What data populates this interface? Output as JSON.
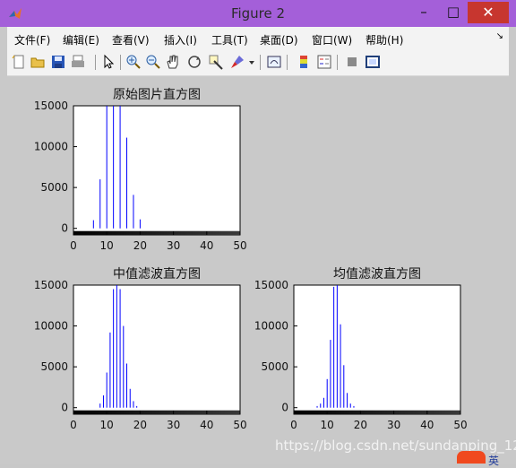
{
  "window": {
    "title": "Figure 2",
    "minimize": "–",
    "maximize": "□",
    "close": "✕",
    "app_icon": "matlab-icon"
  },
  "menu": {
    "items": [
      "文件(F)",
      "编辑(E)",
      "查看(V)",
      "插入(I)",
      "工具(T)",
      "桌面(D)",
      "窗口(W)",
      "帮助(H)"
    ],
    "dock_glyph": "↘"
  },
  "toolbar": {
    "icons": [
      "new-figure-icon",
      "open-file-icon",
      "save-icon",
      "print-icon",
      "pointer-icon",
      "zoom-in-icon",
      "zoom-out-icon",
      "pan-hand-icon",
      "rotate-3d-icon",
      "data-cursor-icon",
      "brush-icon",
      "link-plot-icon",
      "colorbar-icon",
      "legend-icon",
      "hide-plot-tools-icon",
      "show-plot-tools-icon"
    ]
  },
  "colors": {
    "title_bar": "#a45fd9",
    "menu_bg": "#f3f3f3",
    "figure_bg": "#c9c9c9",
    "bar_color": "#0000ff"
  },
  "chart_data": [
    {
      "type": "bar",
      "title": "原始图片直方图",
      "xlim": [
        0,
        50
      ],
      "ylim": [
        -800,
        15000
      ],
      "x_ticks": [
        0,
        10,
        20,
        30,
        40,
        50
      ],
      "y_ticks": [
        0,
        5000,
        10000,
        15000
      ],
      "gray_colorbar": true,
      "bars": [
        {
          "x": 6,
          "value": 1000
        },
        {
          "x": 8,
          "value": 6000
        },
        {
          "x": 10,
          "value": 16000
        },
        {
          "x": 12,
          "value": 16000
        },
        {
          "x": 14,
          "value": 16000
        },
        {
          "x": 16,
          "value": 11100
        },
        {
          "x": 18,
          "value": 4100
        },
        {
          "x": 20,
          "value": 1100
        }
      ]
    },
    {
      "type": "bar",
      "title": "中值滤波直方图",
      "xlim": [
        0,
        50
      ],
      "ylim": [
        -800,
        15000
      ],
      "x_ticks": [
        0,
        10,
        20,
        30,
        40,
        50
      ],
      "y_ticks": [
        0,
        5000,
        10000,
        15000
      ],
      "gray_colorbar": true,
      "bars": [
        {
          "x": 8,
          "value": 500
        },
        {
          "x": 9,
          "value": 1500
        },
        {
          "x": 10,
          "value": 4300
        },
        {
          "x": 11,
          "value": 9200
        },
        {
          "x": 12,
          "value": 14500
        },
        {
          "x": 13,
          "value": 16000
        },
        {
          "x": 14,
          "value": 14500
        },
        {
          "x": 15,
          "value": 10000
        },
        {
          "x": 16,
          "value": 5400
        },
        {
          "x": 17,
          "value": 2300
        },
        {
          "x": 18,
          "value": 800
        },
        {
          "x": 19,
          "value": 200
        }
      ]
    },
    {
      "type": "bar",
      "title": "均值滤波直方图",
      "xlim": [
        0,
        50
      ],
      "ylim": [
        -800,
        15000
      ],
      "x_ticks": [
        0,
        10,
        20,
        30,
        40,
        50
      ],
      "y_ticks": [
        0,
        5000,
        10000,
        15000
      ],
      "gray_colorbar": true,
      "bars": [
        {
          "x": 7,
          "value": 200
        },
        {
          "x": 8,
          "value": 500
        },
        {
          "x": 9,
          "value": 1200
        },
        {
          "x": 10,
          "value": 3500
        },
        {
          "x": 11,
          "value": 8300
        },
        {
          "x": 12,
          "value": 14800
        },
        {
          "x": 13,
          "value": 16000
        },
        {
          "x": 14,
          "value": 10200
        },
        {
          "x": 15,
          "value": 5200
        },
        {
          "x": 16,
          "value": 1800
        },
        {
          "x": 17,
          "value": 500
        },
        {
          "x": 18,
          "value": 200
        }
      ]
    }
  ],
  "watermark": {
    "text": "https://blog.csdn.net/sundanping_123",
    "badge_char": "英"
  }
}
